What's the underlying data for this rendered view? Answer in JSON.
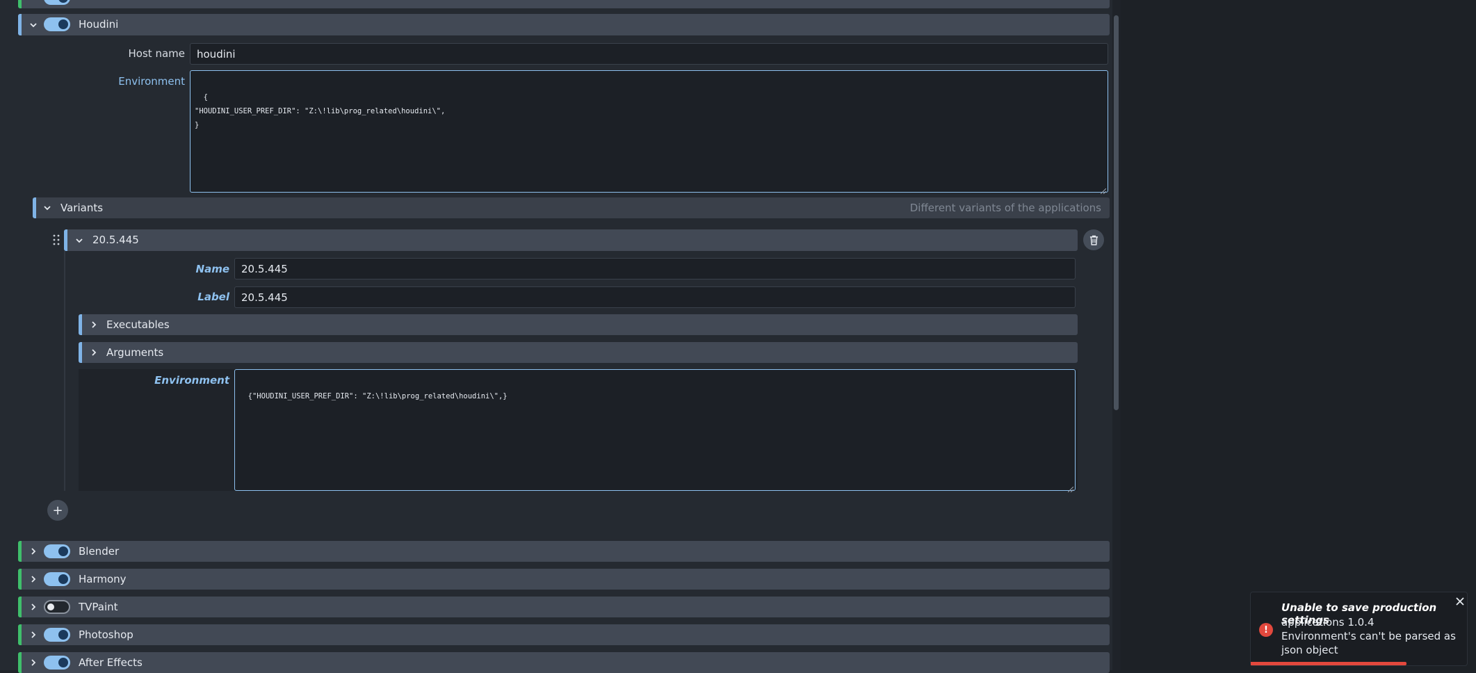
{
  "apps": {
    "houdini": {
      "label": "Houdini",
      "enabled": true,
      "expanded": true
    },
    "blender": {
      "label": "Blender",
      "enabled": true
    },
    "harmony": {
      "label": "Harmony",
      "enabled": true
    },
    "tvpaint": {
      "label": "TVPaint",
      "enabled": false
    },
    "photoshop": {
      "label": "Photoshop",
      "enabled": true
    },
    "aftereffects": {
      "label": "After Effects",
      "enabled": true
    }
  },
  "houdini_settings": {
    "host_name_label": "Host name",
    "host_name_value": "houdini",
    "environment_label": "Environment",
    "environment_value": "{\n\"HOUDINI_USER_PREF_DIR\": \"Z:\\!lib\\prog_related\\houdini\\\",\n}"
  },
  "variants": {
    "label": "Variants",
    "description": "Different variants of the applications",
    "items": [
      {
        "title": "20.5.445",
        "name_label": "Name",
        "name_value": "20.5.445",
        "label_label": "Label",
        "label_value": "20.5.445",
        "executables_label": "Executables",
        "arguments_label": "Arguments",
        "environment_label": "Environment",
        "environment_value": "{\"HOUDINI_USER_PREF_DIR\": \"Z:\\!lib\\prog_related\\houdini\\\",}"
      }
    ],
    "add_label": "+"
  },
  "toast": {
    "title": "Unable to save production settings",
    "line1": "applications 1.0.4",
    "line2": "Environment's can't be parsed as",
    "line3": "json object",
    "icon_text": "!",
    "progress_fraction": 0.72
  },
  "colors": {
    "accent": "#8ec1ef",
    "enabled_edge": "#3fbf6b",
    "error": "#e2483d"
  }
}
